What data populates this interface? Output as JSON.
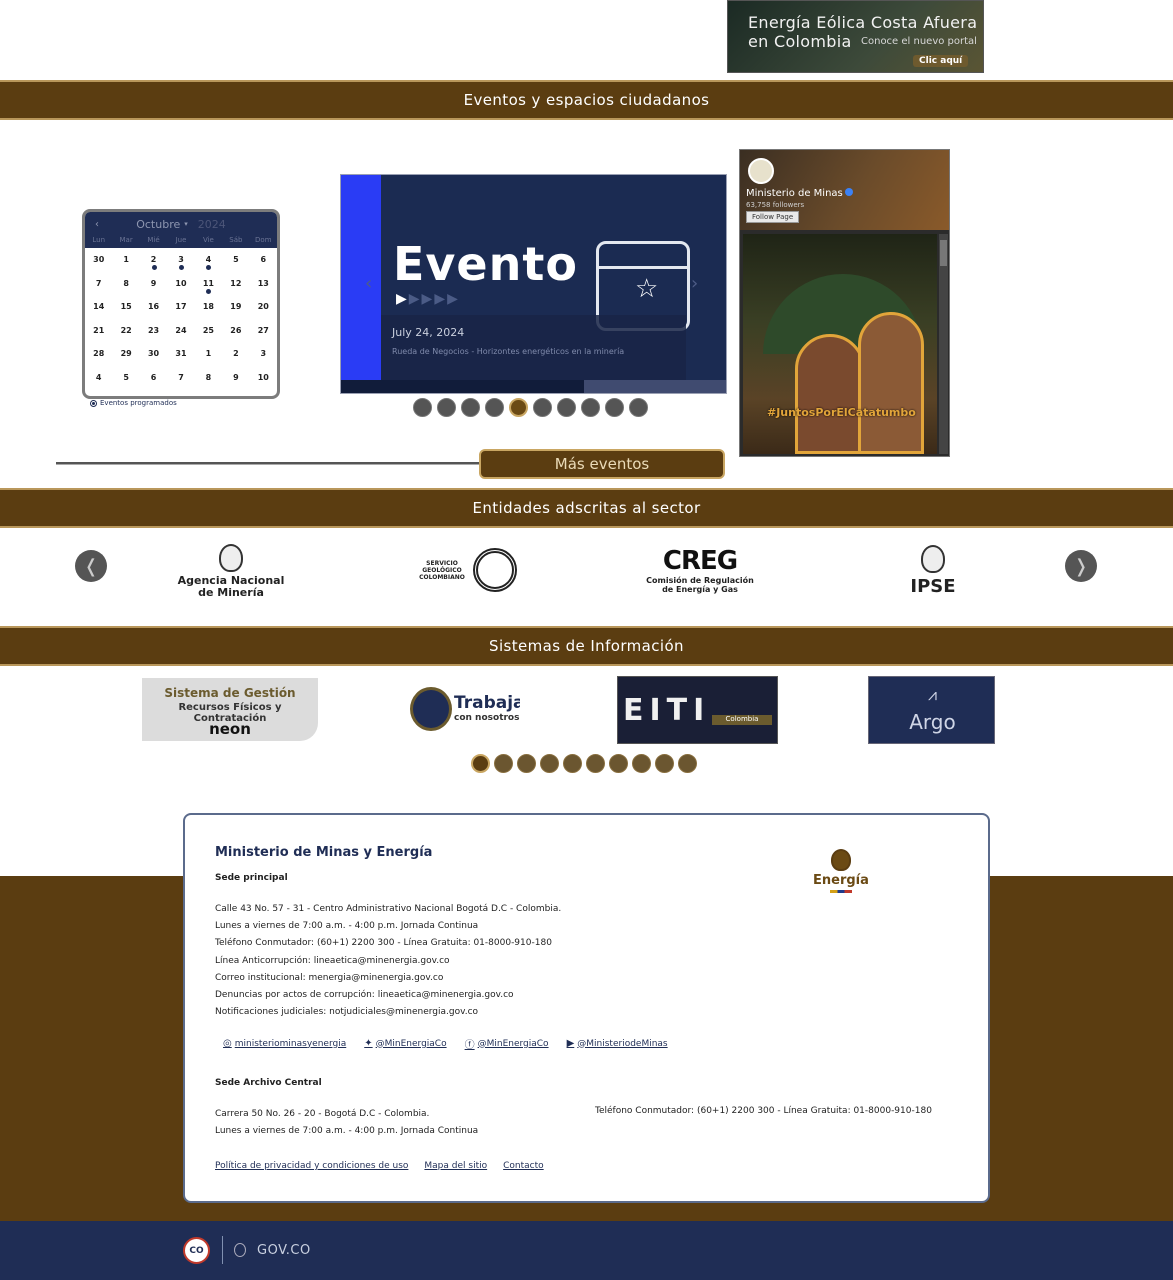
{
  "banner": {
    "title": "Energía Eólica Costa Afuera en Colombia",
    "subtitle": "Conoce el nuevo portal",
    "button": "Clic aquí"
  },
  "sections": {
    "events": "Eventos y espacios ciudadanos",
    "entities": "Entidades adscritas al sector",
    "systems": "Sistemas de Información"
  },
  "calendar": {
    "month": "Octubre",
    "year": "2024",
    "weekdays": [
      "Lun",
      "Mar",
      "Mié",
      "Jue",
      "Vie",
      "Sáb",
      "Dom"
    ],
    "days": [
      "30",
      "1",
      "2",
      "3",
      "4",
      "5",
      "6",
      "7",
      "8",
      "9",
      "10",
      "11",
      "12",
      "13",
      "14",
      "15",
      "16",
      "17",
      "18",
      "19",
      "20",
      "21",
      "22",
      "23",
      "24",
      "25",
      "26",
      "27",
      "28",
      "29",
      "30",
      "31",
      "1",
      "2",
      "3",
      "4",
      "5",
      "6",
      "7",
      "8",
      "9",
      "10"
    ],
    "event_days": [
      "2",
      "3",
      "4",
      "11"
    ],
    "legend": "Eventos programados"
  },
  "event_slider": {
    "title": "Evento",
    "date": "July 24, 2024",
    "description": "Rueda de Negocios - Horizontes energéticos en la minería",
    "active_index": 4,
    "slide_count": 10
  },
  "more_events_button": "Más eventos",
  "facebook": {
    "page_name": "Ministerio de Minas",
    "followers": "63,758 followers",
    "follow_label": "Follow Page",
    "post_hashtag": "#JuntosPorElCatatumbo"
  },
  "entities": [
    {
      "name": "Agencia Nacional de Minería"
    },
    {
      "name": "SERVICIO GEOLÓGICO COLOMBIANO"
    },
    {
      "name": "CREG",
      "sub": "Comisión de Regulación de Energía y Gas"
    },
    {
      "name": "IPSE"
    }
  ],
  "systems": [
    {
      "line1": "Sistema de Gestión",
      "line2": "Recursos Físicos y Contratación",
      "brand": "neon"
    },
    {
      "line1": "Trabaja",
      "line2": "con nosotros"
    },
    {
      "line1": "EITI",
      "line2": "Colombia"
    },
    {
      "line1": "Argo"
    }
  ],
  "systems_slider": {
    "active_index": 0,
    "slide_count": 10
  },
  "footer": {
    "title": "Ministerio de Minas y Energía",
    "main_office_heading": "Sede principal",
    "main_office_lines": [
      "Calle 43 No. 57 - 31 - Centro Administrativo Nacional Bogotá D.C - Colombia.",
      "Lunes a viernes de 7:00 a.m. - 4:00 p.m. Jornada Continua",
      "Teléfono Conmutador: (60+1) 2200 300 - Línea Gratuita: 01-8000-910-180",
      "Línea Anticorrupción: lineaetica@minenergia.gov.co",
      "Correo institucional: menergia@minenergia.gov.co",
      "Denuncias por actos de corrupción: lineaetica@minenergia.gov.co",
      "Notificaciones judiciales: notjudiciales@minenergia.gov.co"
    ],
    "social": [
      {
        "icon": "instagram-icon",
        "glyph": "◎",
        "label": "ministeriominasyenergia"
      },
      {
        "icon": "twitter-icon",
        "glyph": "✦",
        "label": "@MinEnergiaCo"
      },
      {
        "icon": "facebook-icon",
        "glyph": "ⓕ",
        "label": "@MinEnergiaCo"
      },
      {
        "icon": "youtube-icon",
        "glyph": "▶",
        "label": "@MinisteriodeMinas"
      }
    ],
    "archive_heading": "Sede Archivo Central",
    "archive_lines": [
      "Carrera 50 No. 26 - 20 - Bogotá D.C - Colombia.",
      "Lunes a viernes de 7:00 a.m. - 4:00 p.m. Jornada Continua"
    ],
    "archive_phone": "Teléfono Conmutador: (60+1) 2200 300 - Línea Gratuita: 01-8000-910-180",
    "links": [
      "Política de privacidad y condiciones de uso",
      "Mapa del sitio",
      "Contacto"
    ],
    "brand_word": "Energía"
  },
  "gov_bar": {
    "badge": "CO",
    "label": "GOV.CO"
  },
  "colors": {
    "brand_brown": "#5b3d11",
    "gold": "#c9a662",
    "navy": "#1f2d55"
  }
}
